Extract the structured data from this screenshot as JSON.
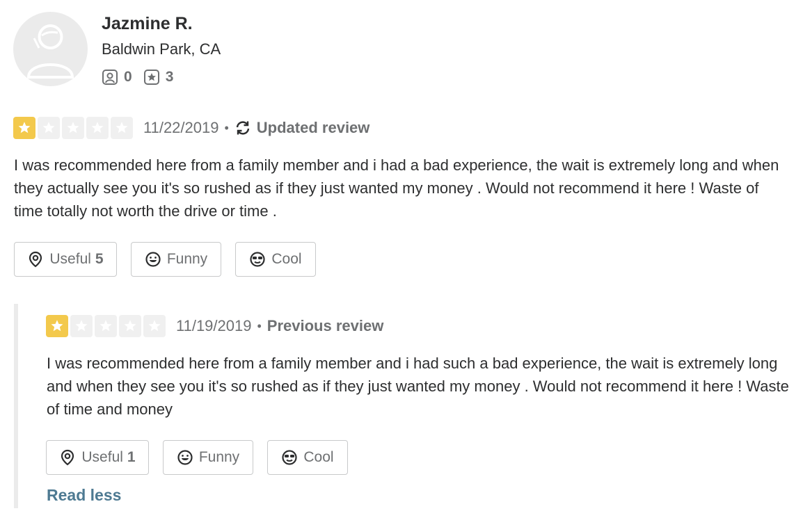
{
  "user": {
    "name": "Jazmine R.",
    "location": "Baldwin Park, CA",
    "friends_count": "0",
    "reviews_count": "3"
  },
  "current_review": {
    "rating": 1,
    "max_rating": 5,
    "date": "11/22/2019",
    "status": "Updated review",
    "text": "I was recommended here from a family member and i had a bad experience, the wait is extremely long and when they actually see you it's so rushed as if they just wanted my money . Would not recommend it here ! Waste of time totally not worth the drive or time .",
    "useful_label": "Useful",
    "useful_count": "5",
    "funny_label": "Funny",
    "cool_label": "Cool"
  },
  "previous_review": {
    "rating": 1,
    "max_rating": 5,
    "date": "11/19/2019",
    "status": "Previous review",
    "text": "I was recommended here from a family member and i had such a bad experience, the wait is extremely long and when they see you it's so rushed as if they just wanted my money . Would not recommend it here ! Waste of time and money",
    "useful_label": "Useful",
    "useful_count": "1",
    "funny_label": "Funny",
    "cool_label": "Cool"
  },
  "read_less_label": "Read less",
  "colors": {
    "star_on": "#f3c94c",
    "star_off": "#f0f0f0",
    "link": "#4e7a92",
    "text": "#2d2e2f",
    "muted": "#6e7072"
  },
  "icons": [
    "user-avatar-icon",
    "friends-icon",
    "reviews-star-icon",
    "star-icon",
    "update-icon",
    "useful-icon",
    "funny-icon",
    "cool-icon"
  ]
}
